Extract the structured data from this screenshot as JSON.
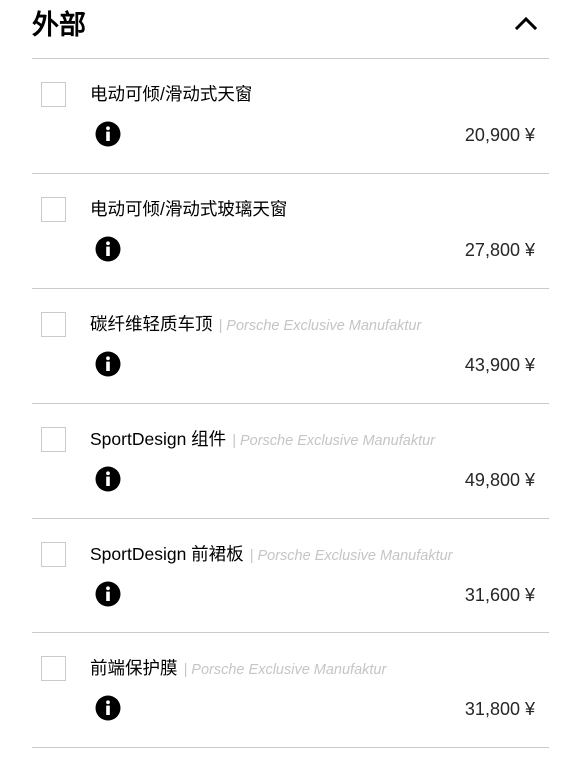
{
  "section": {
    "title": "外部",
    "collapse_icon": "chevron-up-icon"
  },
  "options": [
    {
      "name": "电动可倾/滑动式天窗",
      "sub": "",
      "price": "20,900 ¥"
    },
    {
      "name": "电动可倾/滑动式玻璃天窗",
      "sub": "",
      "price": "27,800 ¥"
    },
    {
      "name": "碳纤维轻质车顶",
      "sub": "| Porsche Exclusive Manufaktur",
      "price": "43,900 ¥"
    },
    {
      "name": "SportDesign 组件",
      "sub": "| Porsche Exclusive Manufaktur",
      "price": "49,800 ¥"
    },
    {
      "name": "SportDesign 前裙板",
      "sub": "| Porsche Exclusive Manufaktur",
      "price": "31,600 ¥"
    },
    {
      "name": "前端保护膜",
      "sub": "| Porsche Exclusive Manufaktur",
      "price": "31,800 ¥"
    }
  ],
  "colors": {
    "divider": "#c9cacb",
    "subtext": "#c3c5c7",
    "text": "#000000"
  },
  "icons": {
    "info": "info-icon",
    "checkbox": "checkbox-empty"
  }
}
